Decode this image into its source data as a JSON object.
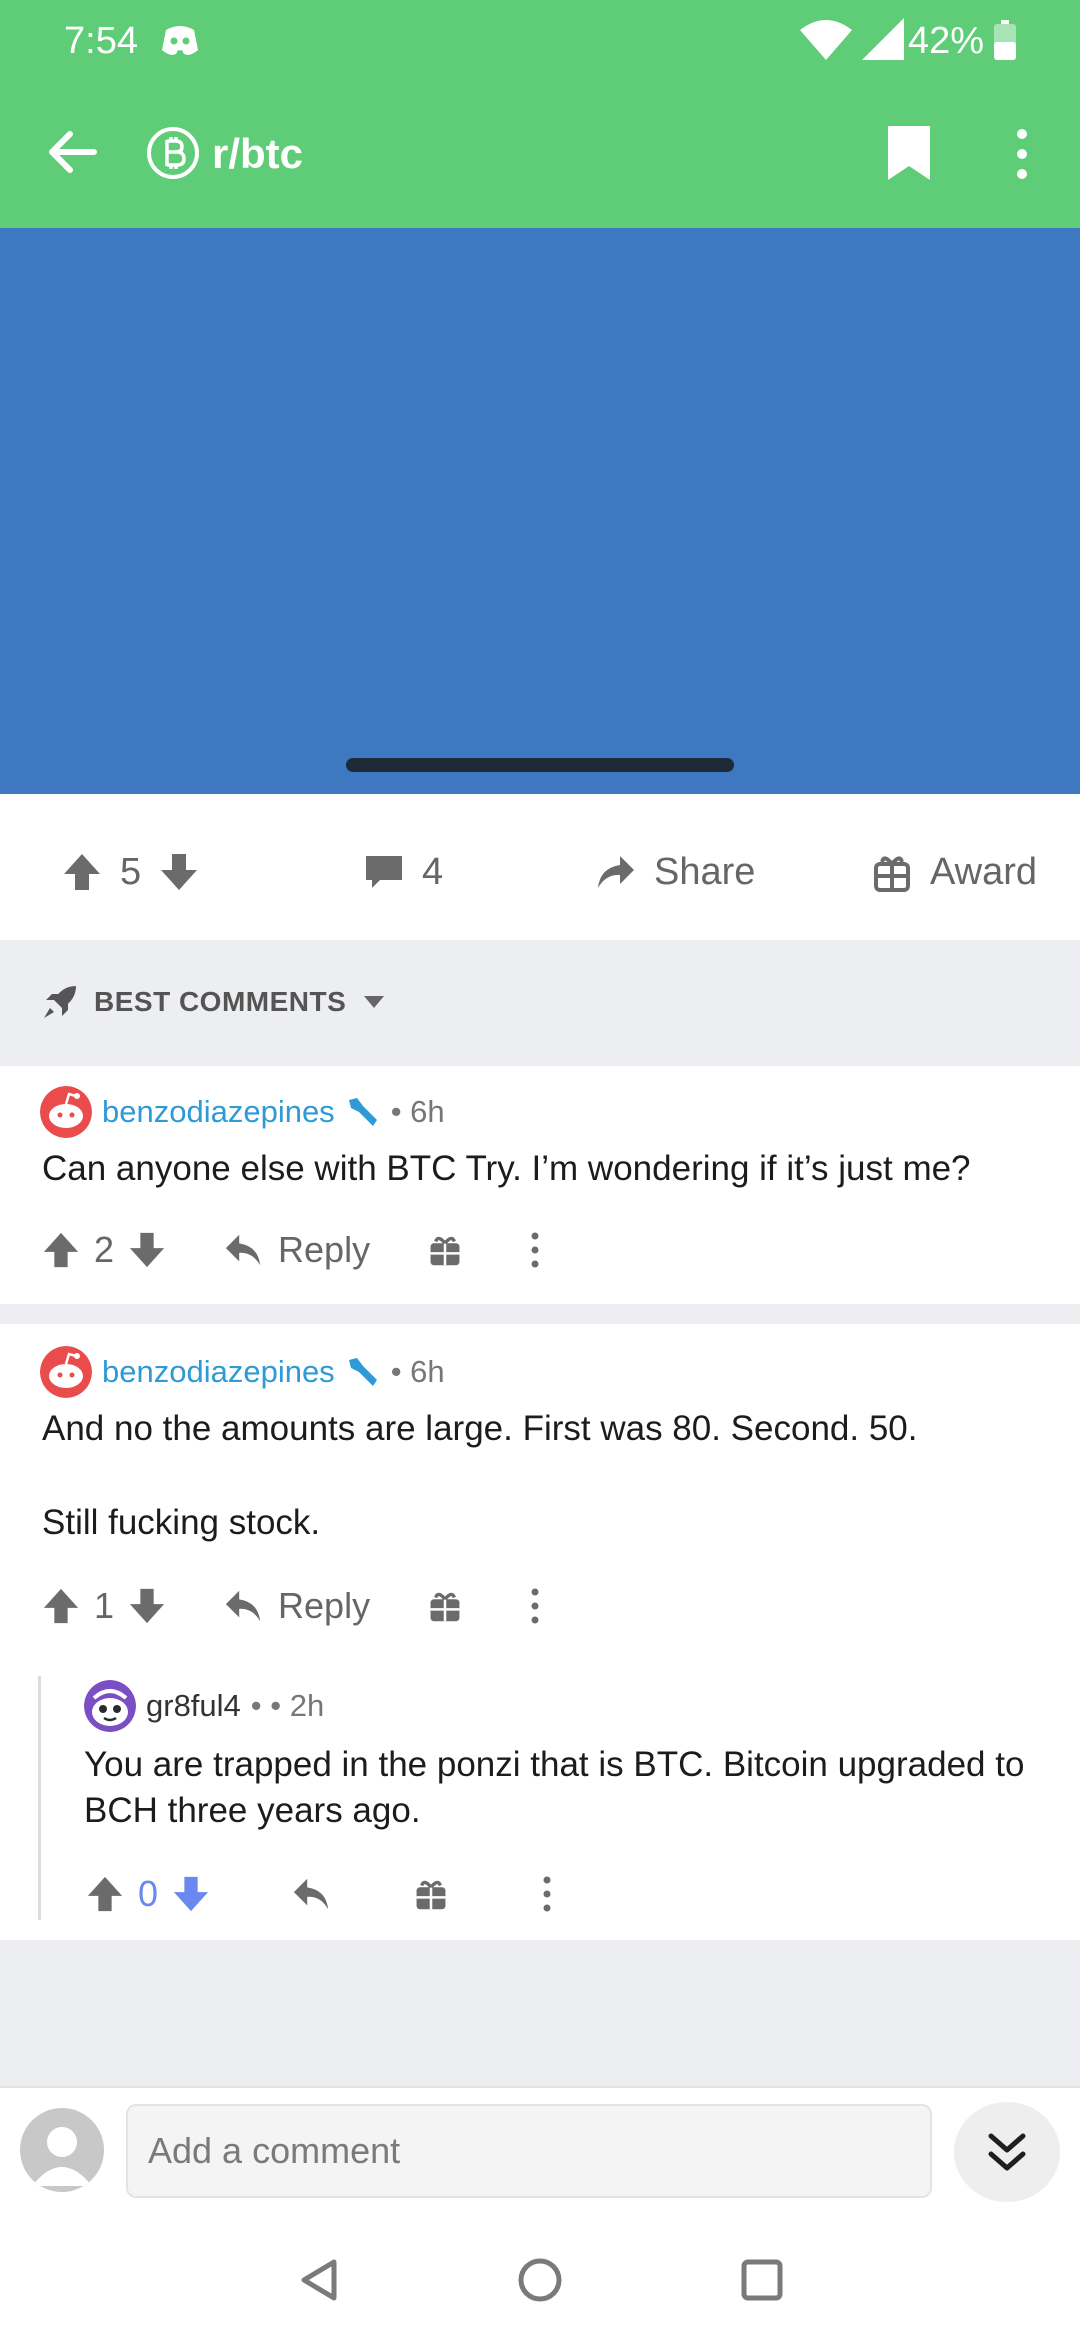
{
  "status": {
    "time": "7:54",
    "battery": "42%"
  },
  "appbar": {
    "subreddit": "r/btc"
  },
  "post": {
    "votes": "5",
    "comments": "4",
    "share_label": "Share",
    "award_label": "Award"
  },
  "sort": {
    "label": "BEST COMMENTS"
  },
  "comments": [
    {
      "author": "benzodiazepines",
      "age": "• 6h",
      "body": "Can anyone else with BTC Try. I’m wondering if it’s just me?",
      "votes": "2",
      "reply_label": "Reply"
    },
    {
      "author": "benzodiazepines",
      "age": "• 6h",
      "body_line1": "And no the amounts are large. First was 80. Second. 50.",
      "body_line2": "Still fucking stock.",
      "votes": "1",
      "reply_label": "Reply"
    },
    {
      "author": "gr8ful4",
      "age": "•  • 2h",
      "body": "You are trapped in the ponzi that is BTC. Bitcoin upgraded to BCH three years ago.",
      "votes": "0"
    }
  ],
  "composer": {
    "placeholder": "Add a comment"
  },
  "colors": {
    "header_green": "#5fcc78",
    "media_blue": "#3d78c1",
    "link_blue": "#2f9ad6",
    "downvote_blue": "#6a88f0"
  }
}
